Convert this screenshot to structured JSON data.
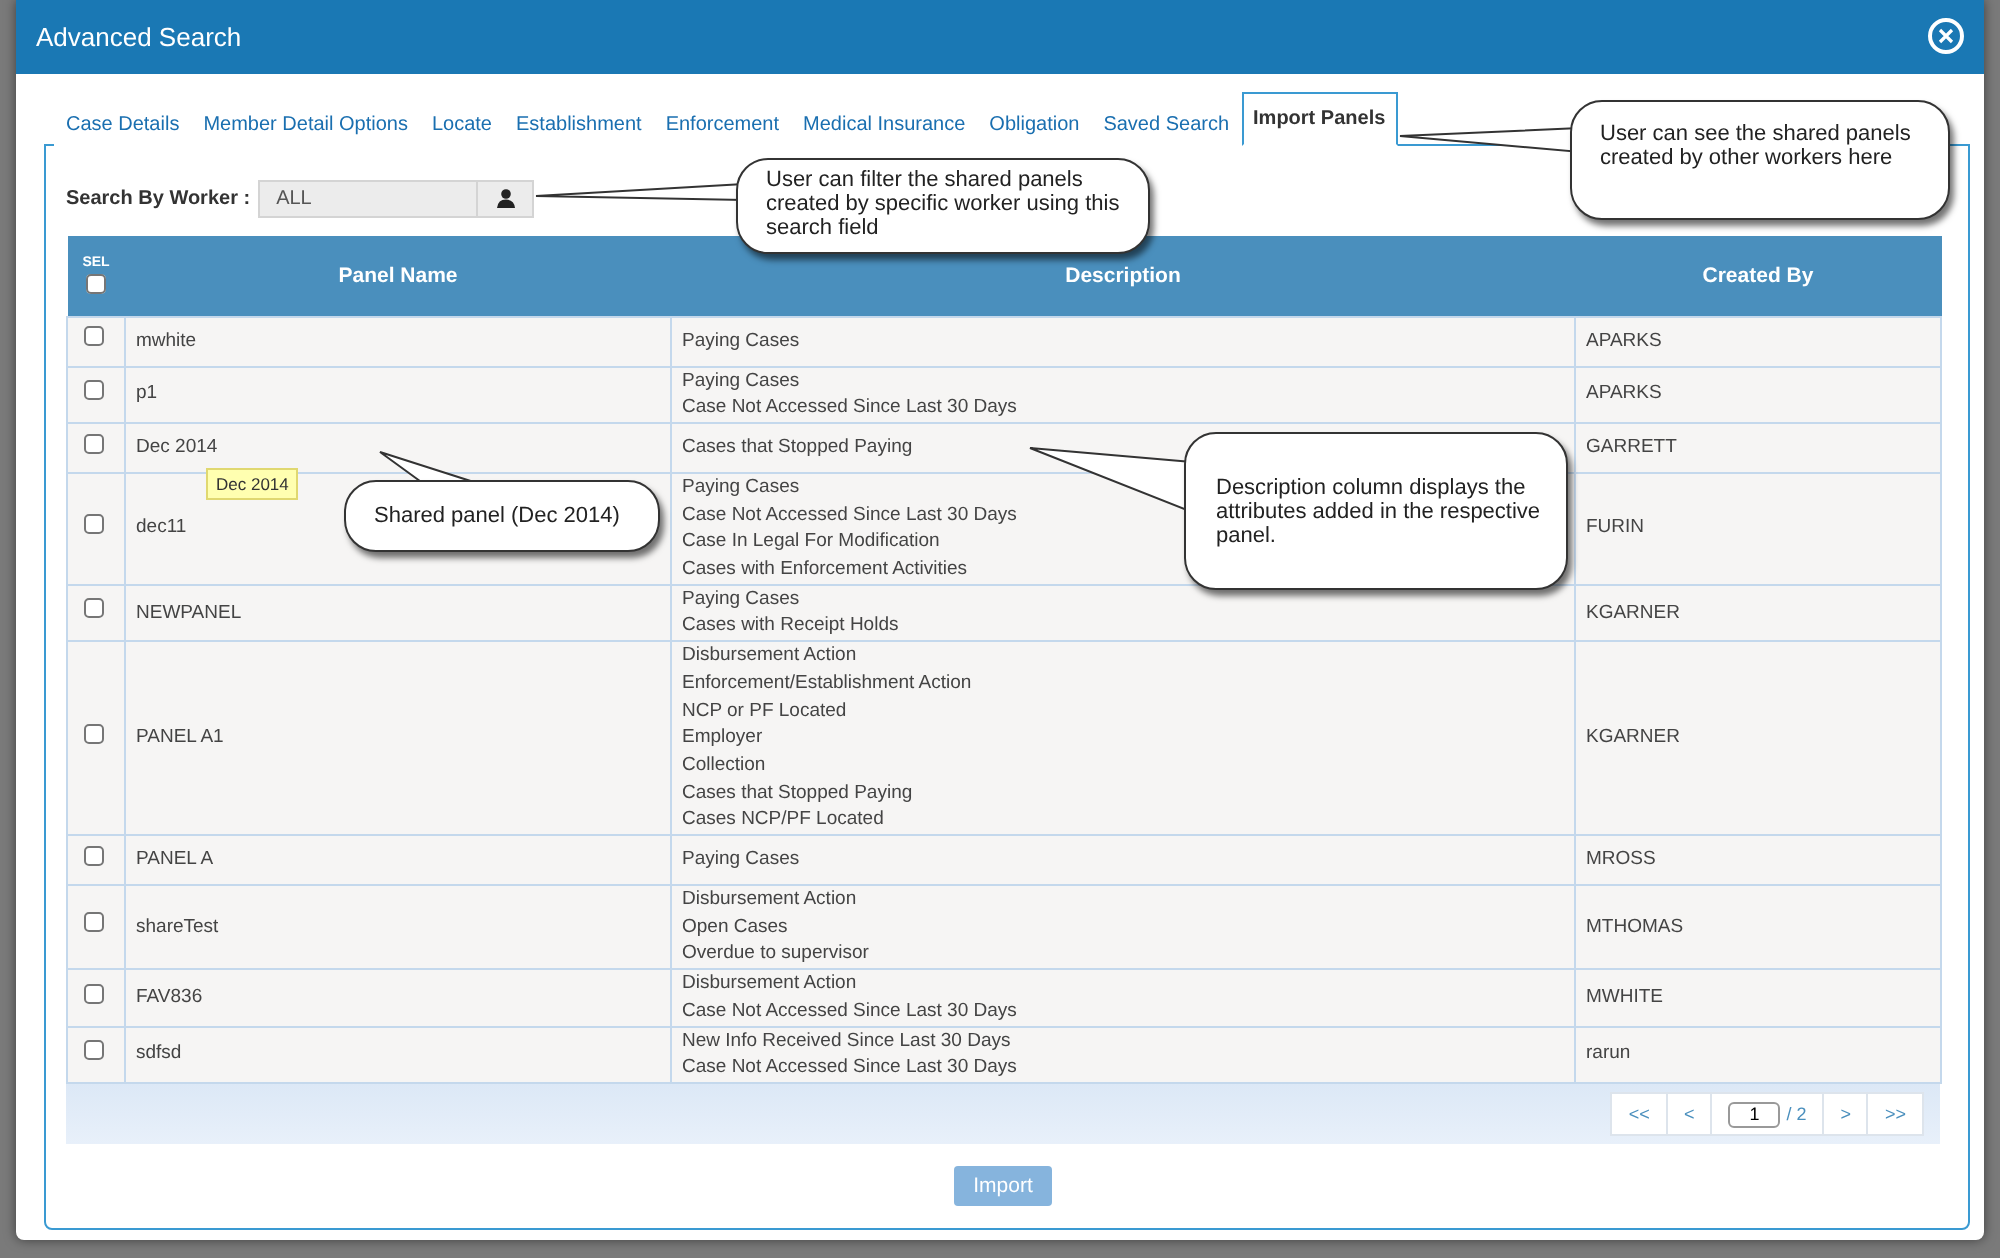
{
  "window": {
    "title": "Advanced Search"
  },
  "tabs": [
    {
      "label": "Case Details",
      "selected": false
    },
    {
      "label": "Member Detail Options",
      "selected": false
    },
    {
      "label": "Locate",
      "selected": false
    },
    {
      "label": "Establishment",
      "selected": false
    },
    {
      "label": "Enforcement",
      "selected": false
    },
    {
      "label": "Medical Insurance",
      "selected": false
    },
    {
      "label": "Obligation",
      "selected": false
    },
    {
      "label": "Saved Search",
      "selected": false
    },
    {
      "label": "Import Panels",
      "selected": true
    }
  ],
  "search": {
    "label": "Search By Worker :",
    "value": "ALL"
  },
  "table": {
    "columns": [
      "SEL",
      "Panel Name",
      "Description",
      "Created By"
    ],
    "select_all_checked": false,
    "rows": [
      {
        "checked": false,
        "name": "mwhite",
        "description": [
          "Paying Cases"
        ],
        "created_by": "APARKS"
      },
      {
        "checked": false,
        "name": "p1",
        "description": [
          "Paying Cases",
          "Case Not Accessed Since Last 30 Days"
        ],
        "created_by": "APARKS"
      },
      {
        "checked": false,
        "name": "Dec 2014",
        "description": [
          "Cases that Stopped Paying"
        ],
        "created_by": "GARRETT"
      },
      {
        "checked": false,
        "name": "dec11",
        "description": [
          "Paying Cases",
          "Case Not Accessed Since Last 30 Days",
          "Case In Legal For Modification",
          "Cases with Enforcement Activities"
        ],
        "created_by": "FURIN"
      },
      {
        "checked": false,
        "name": "NEWPANEL",
        "description": [
          "Paying Cases",
          "Cases with Receipt Holds"
        ],
        "created_by": "KGARNER"
      },
      {
        "checked": false,
        "name": "PANEL A1",
        "description": [
          "Disbursement Action",
          "Enforcement/Establishment Action",
          "NCP or PF Located",
          "Employer",
          "Collection",
          "Cases that Stopped Paying",
          "Cases NCP/PF Located"
        ],
        "created_by": "KGARNER"
      },
      {
        "checked": false,
        "name": "PANEL A",
        "description": [
          "Paying Cases"
        ],
        "created_by": "MROSS"
      },
      {
        "checked": false,
        "name": "shareTest",
        "description": [
          "Disbursement Action",
          "Open Cases",
          "Overdue to supervisor"
        ],
        "created_by": "MTHOMAS"
      },
      {
        "checked": false,
        "name": "FAV836",
        "description": [
          "Disbursement Action",
          "Case Not Accessed Since Last 30 Days"
        ],
        "created_by": "MWHITE"
      },
      {
        "checked": false,
        "name": "sdfsd",
        "description": [
          "New Info Received Since Last 30 Days",
          "Case Not Accessed Since Last 30 Days"
        ],
        "created_by": "rarun"
      }
    ]
  },
  "pagination": {
    "first": "<<",
    "prev": "<",
    "page": "1",
    "total": "/ 2",
    "next": ">",
    "last": ">>"
  },
  "import_button": {
    "label": "Import",
    "disabled": true
  },
  "tooltip": "Dec 2014",
  "callouts": [
    {
      "text": "User can see the shared panels created by other workers here"
    },
    {
      "text": "User can filter the shared panels created by specific worker using this search field"
    },
    {
      "text": "Shared panel (Dec 2014)"
    },
    {
      "text": "Description column displays the attributes added in the respective panel."
    }
  ]
}
